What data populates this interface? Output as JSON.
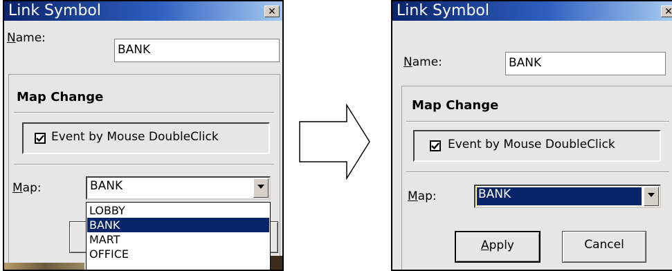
{
  "left_dialog": {
    "title": "Link Symbol",
    "close_glyph": "✕",
    "name_label_mnemonic": "N",
    "name_label_rest": "ame:",
    "name_value": "BANK",
    "group_title": "Map Change",
    "checkbox_label": "Event by Mouse DoubleClick",
    "checkbox_checked": true,
    "map_label_mnemonic": "M",
    "map_label_rest": "ap:",
    "map_value": "BANK",
    "dropdown_open": true,
    "dropdown_options": [
      "LOBBY",
      "BANK",
      "MART",
      "OFFICE"
    ],
    "dropdown_selected": "BANK"
  },
  "right_dialog": {
    "title": "Link Symbol",
    "close_glyph": "✕",
    "name_label_mnemonic": "N",
    "name_label_rest": "ame:",
    "name_value": "BANK",
    "group_title": "Map Change",
    "checkbox_label": "Event by Mouse DoubleClick",
    "checkbox_checked": true,
    "map_label_mnemonic": "M",
    "map_label_rest": "ap:",
    "map_value": "BANK",
    "apply_mnemonic": "A",
    "apply_rest": "pply",
    "cancel_label": "Cancel"
  },
  "transition": {
    "icon": "right-arrow-icon"
  },
  "colors": {
    "title_start": "#0a246a",
    "title_end": "#a6caf0",
    "selection": "#0a246a",
    "dialog_bg": "#e6e6e6"
  }
}
